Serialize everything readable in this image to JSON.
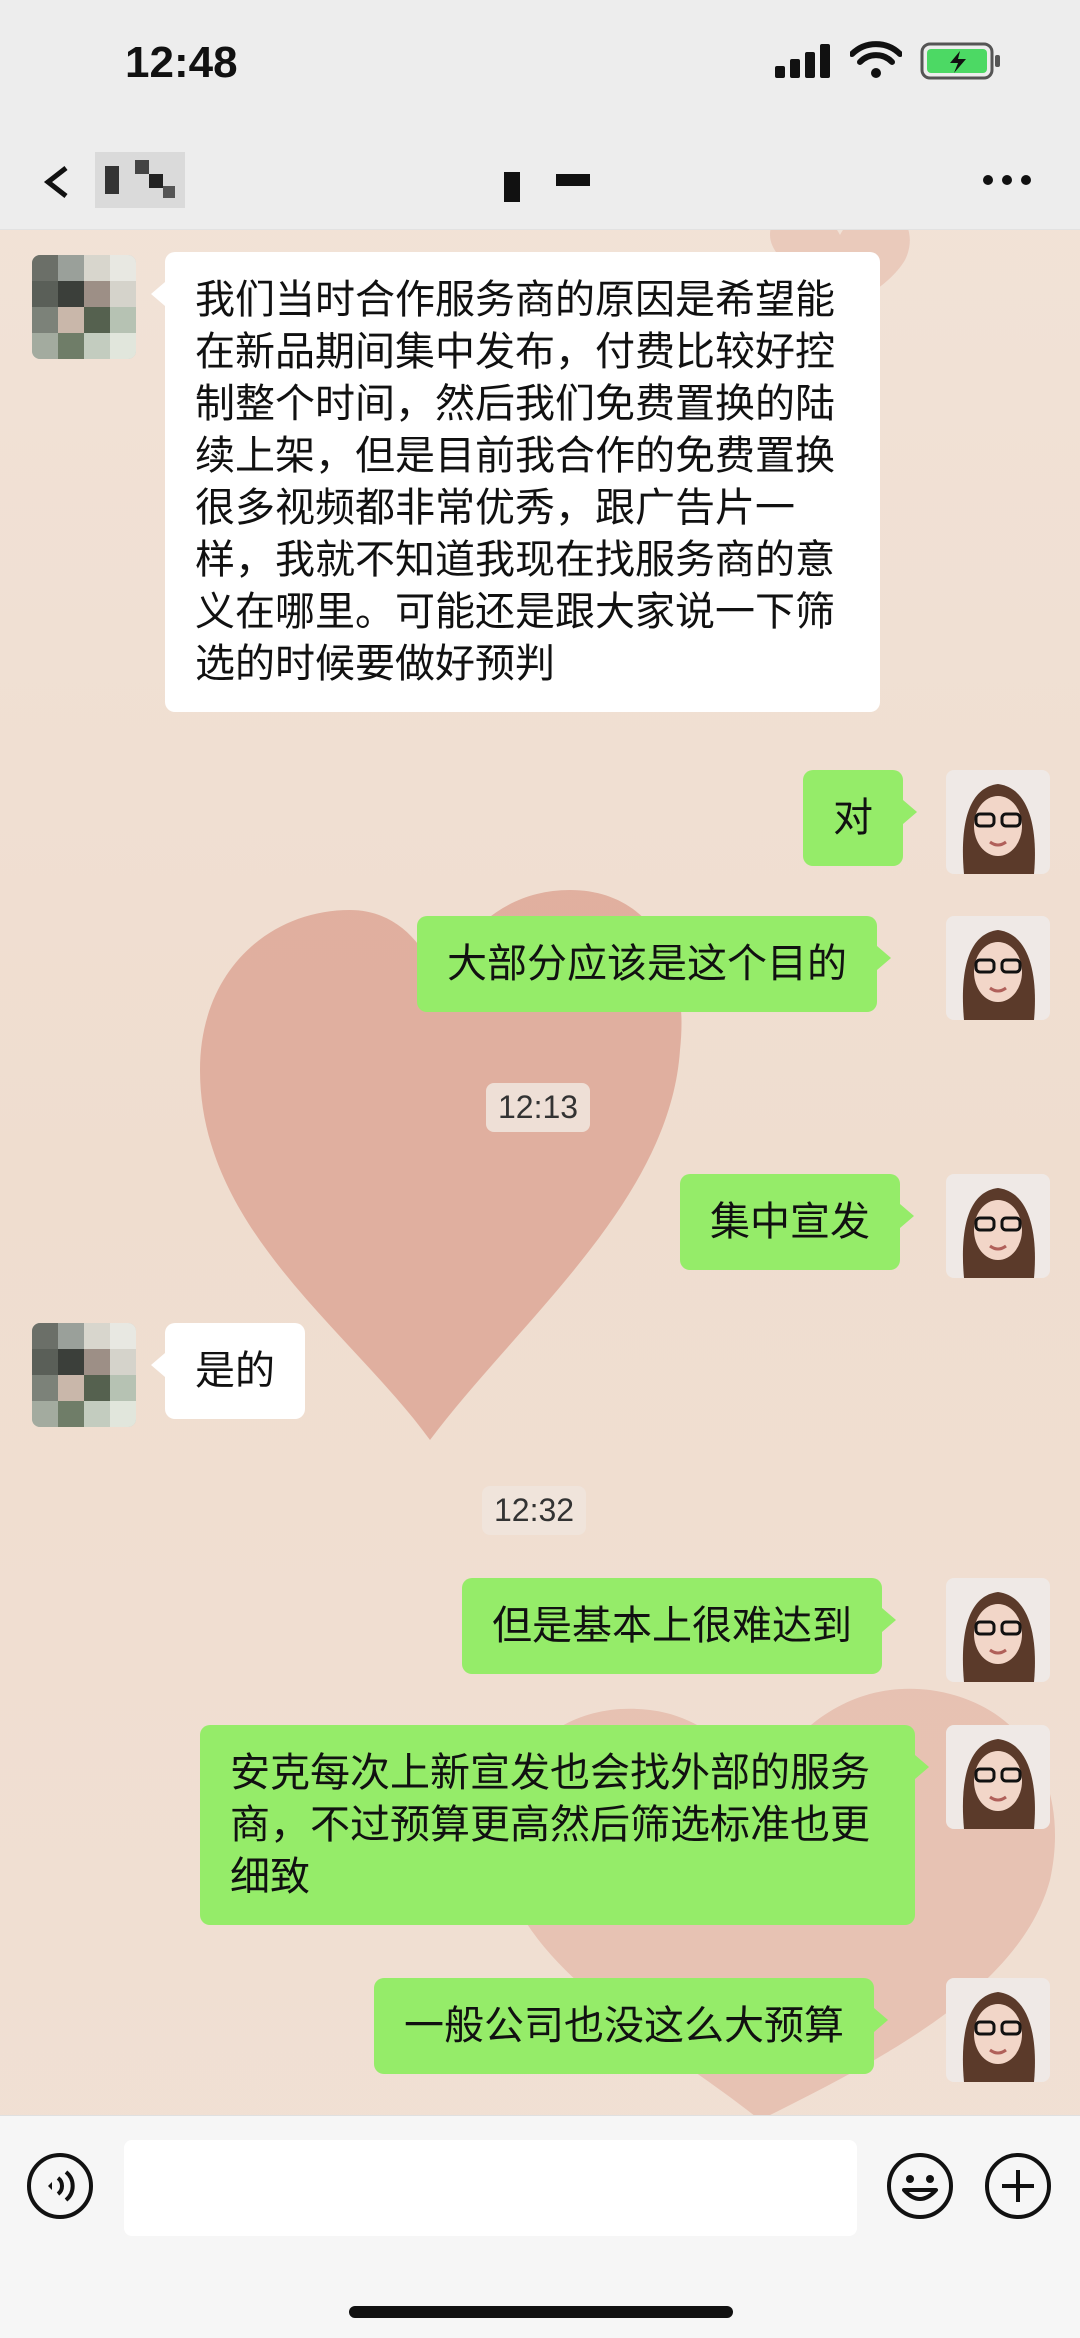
{
  "status_bar": {
    "time": "12:48"
  },
  "nav": {
    "back_icon": "back-arrow-icon",
    "more_icon": "more-dots-icon"
  },
  "messages": [
    {
      "side": "in",
      "text": "我们当时合作服务商的原因是希望能在新品期间集中发布，付费比较好控制整个时间，然后我们免费置换的陆续上架，但是目前我合作的免费置换很多视频都非常优秀，跟广告片一样，我就不知道我现在找服务商的意义在哪里。可能还是跟大家说一下筛选的时候要做好预判"
    },
    {
      "side": "out",
      "text": "对"
    },
    {
      "side": "out",
      "text": "大部分应该是这个目的"
    },
    {
      "side": "time",
      "text": "12:13"
    },
    {
      "side": "out",
      "text": "集中宣发"
    },
    {
      "side": "in",
      "text": "是的"
    },
    {
      "side": "time",
      "text": "12:32"
    },
    {
      "side": "out",
      "text": "但是基本上很难达到"
    },
    {
      "side": "out",
      "text": "安克每次上新宣发也会找外部的服务商，不过预算更高然后筛选标准也更细致"
    },
    {
      "side": "out",
      "text": "一般公司也没这么大预算"
    }
  ],
  "input_bar": {
    "voice_icon": "voice-icon",
    "emoji_icon": "emoji-icon",
    "plus_icon": "plus-icon",
    "placeholder": ""
  },
  "colors": {
    "outgoing_bubble": "#95ec69",
    "incoming_bubble": "#ffffff",
    "bar_background": "#ededed"
  }
}
